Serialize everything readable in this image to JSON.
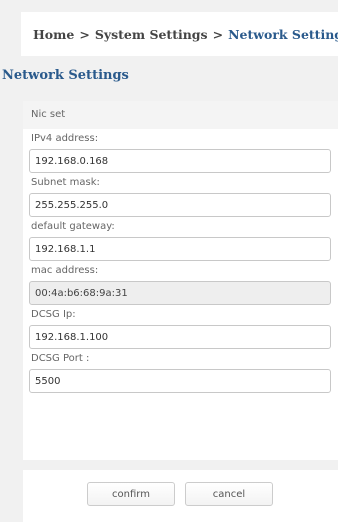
{
  "breadcrumb": {
    "home": "Home",
    "separator1": ">",
    "system_settings": "System Settings",
    "separator2": ">",
    "current": "Network Settings"
  },
  "section_title": "Network Settings",
  "form": {
    "group_header": "Nic set",
    "fields": [
      {
        "label": "IPv4 address:",
        "value": "192.168.0.168"
      },
      {
        "label": "Subnet mask:",
        "value": "255.255.255.0"
      },
      {
        "label": "default gateway:",
        "value": "192.168.1.1"
      },
      {
        "label": "mac address:",
        "value": "00:4a:b6:68:9a:31"
      },
      {
        "label": "DCSG Ip:",
        "value": "192.168.1.100"
      },
      {
        "label": "DCSG Port :",
        "value": "5500"
      }
    ]
  },
  "buttons": {
    "confirm": "confirm",
    "cancel": "cancel"
  }
}
